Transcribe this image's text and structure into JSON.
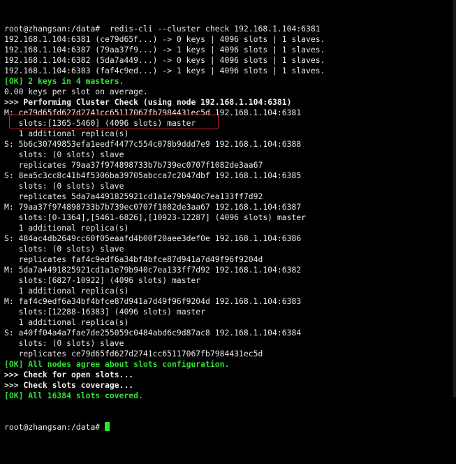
{
  "terminal": {
    "lines": [
      {
        "text": "root@zhangsan:/data#  redis-cli --cluster check 192.168.1.104:6381",
        "style": "white"
      },
      {
        "text": "192.168.1.104:6381 (ce79d65f...) -> 0 keys | 4096 slots | 1 slaves.",
        "style": "white"
      },
      {
        "text": "192.168.1.104:6387 (79aa37f9...) -> 1 keys | 4096 slots | 1 slaves.",
        "style": "white"
      },
      {
        "text": "192.168.1.104:6382 (5da7a449...) -> 0 keys | 4096 slots | 1 slaves.",
        "style": "white"
      },
      {
        "text": "192.168.1.104:6383 (faf4c9ed...) -> 1 keys | 4096 slots | 1 slaves.",
        "style": "white"
      },
      {
        "text": "[OK] 2 keys in 4 masters.",
        "style": "ok"
      },
      {
        "text": "0.00 keys per slot on average.",
        "style": "white"
      },
      {
        "text": ">>> Performing Cluster Check (using node 192.168.1.104:6381)",
        "style": "info"
      },
      {
        "text": "M: ce79d65fd627d2741cc65117067fb7984431ec5d 192.168.1.104:6381",
        "style": "white"
      },
      {
        "text": "   slots:[1365-5460] (4096 slots) master",
        "style": "white"
      },
      {
        "text": "   1 additional replica(s)",
        "style": "white"
      },
      {
        "text": "S: 5b6c30749853efa1eedf4477c554c078b9ddd7e9 192.168.1.104:6388",
        "style": "white"
      },
      {
        "text": "   slots: (0 slots) slave",
        "style": "white"
      },
      {
        "text": "   replicates 79aa37f974898733b7b739ec0707f1082de3aa67",
        "style": "white"
      },
      {
        "text": "S: 8ea5c3cc8c41b4f5306ba39705abcca7c2047dbf 192.168.1.104:6385",
        "style": "white"
      },
      {
        "text": "   slots: (0 slots) slave",
        "style": "white"
      },
      {
        "text": "   replicates 5da7a4491825921cd1a1e79b940c7ea133ff7d92",
        "style": "white"
      },
      {
        "text": "M: 79aa37f974898733b7b739ec0707f1082de3aa67 192.168.1.104:6387",
        "style": "white"
      },
      {
        "text": "   slots:[0-1364],[5461-6826],[10923-12287] (4096 slots) master",
        "style": "white"
      },
      {
        "text": "   1 additional replica(s)",
        "style": "white"
      },
      {
        "text": "S: 484ac4db2649cc60f05eaafd4b00f20aee3def0e 192.168.1.104:6386",
        "style": "white"
      },
      {
        "text": "   slots: (0 slots) slave",
        "style": "white"
      },
      {
        "text": "   replicates faf4c9edf6a34bf4bfce87d941a7d49f96f9204d",
        "style": "white"
      },
      {
        "text": "M: 5da7a4491825921cd1a1e79b940c7ea133ff7d92 192.168.1.104:6382",
        "style": "white"
      },
      {
        "text": "   slots:[6827-10922] (4096 slots) master",
        "style": "white"
      },
      {
        "text": "   1 additional replica(s)",
        "style": "white"
      },
      {
        "text": "M: faf4c9edf6a34bf4bfce87d941a7d49f96f9204d 192.168.1.104:6383",
        "style": "white"
      },
      {
        "text": "   slots:[12288-16383] (4096 slots) master",
        "style": "white"
      },
      {
        "text": "   1 additional replica(s)",
        "style": "white"
      },
      {
        "text": "S: a40ff04a4a7fae7de255059c0484abd6c9d87ac8 192.168.1.104:6384",
        "style": "white"
      },
      {
        "text": "   slots: (0 slots) slave",
        "style": "white"
      },
      {
        "text": "   replicates ce79d65fd627d2741cc65117067fb7984431ec5d",
        "style": "white"
      },
      {
        "text": "[OK] All nodes agree about slots configuration.",
        "style": "ok"
      },
      {
        "text": ">>> Check for open slots...",
        "style": "info"
      },
      {
        "text": ">>> Check slots coverage...",
        "style": "info"
      },
      {
        "text": "[OK] All 16384 slots covered.",
        "style": "ok"
      }
    ],
    "prompt": "root@zhangsan:/data# ",
    "colors": {
      "background": "#000000",
      "text": "#e8e8e8",
      "ok": "#33e033",
      "cursor": "#2ee62e",
      "highlight_border": "#e02020"
    }
  }
}
